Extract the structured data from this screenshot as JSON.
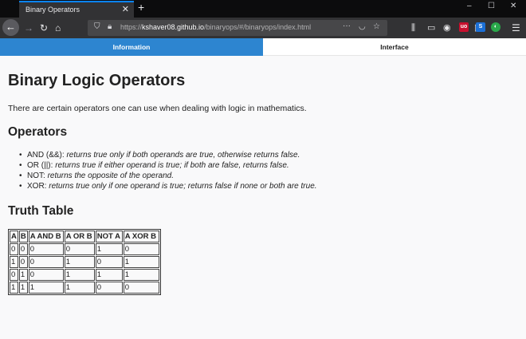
{
  "browser": {
    "tab_title": "Binary Operators",
    "tab_close": "✕",
    "new_tab": "+",
    "url_prefix": "https://",
    "url_host": "kshaver08.github.io",
    "url_path": "/binaryops/#/binaryops/index.html",
    "url_more": "···",
    "min": "–",
    "max": "☐",
    "close": "✕"
  },
  "page": {
    "tabs": [
      "Information",
      "Interface"
    ],
    "title": "Binary Logic Operators",
    "intro": "There are certain operators one can use when dealing with logic in mathematics.",
    "operators_heading": "Operators",
    "operators": [
      {
        "name": "AND (&&): ",
        "desc": "returns true only if both operands are true, otherwise returns false."
      },
      {
        "name": "OR (||): ",
        "desc": "returns true if either operand is true; if both are false, returns false."
      },
      {
        "name": "NOT: ",
        "desc": "returns the opposite of the operand."
      },
      {
        "name": "XOR: ",
        "desc": "returns true only if one operand is true; returns false if none or both are true."
      }
    ],
    "truth_heading": "Truth Table",
    "table": {
      "headers": [
        "A",
        "B",
        "A AND B",
        "A OR B",
        "NOT A",
        "A XOR B"
      ],
      "rows": [
        [
          "0",
          "0",
          "0",
          "0",
          "1",
          "0"
        ],
        [
          "1",
          "0",
          "0",
          "1",
          "0",
          "1"
        ],
        [
          "0",
          "1",
          "0",
          "1",
          "1",
          "1"
        ],
        [
          "1",
          "1",
          "1",
          "1",
          "0",
          "0"
        ]
      ]
    }
  }
}
